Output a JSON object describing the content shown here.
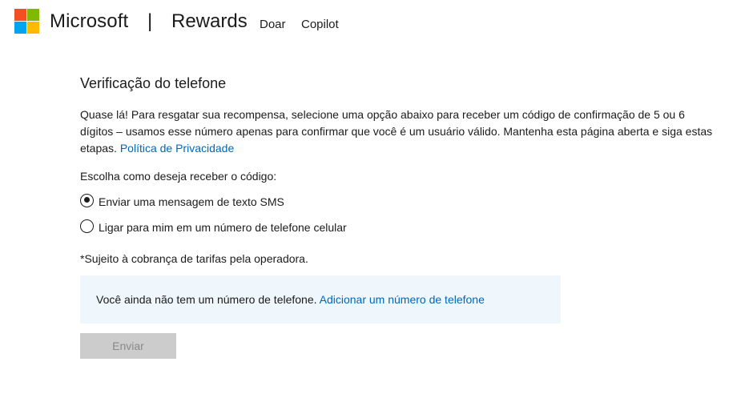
{
  "header": {
    "brand": "Microsoft",
    "divider": "|",
    "product": "Rewards",
    "nav": [
      "Doar",
      "Copilot"
    ],
    "logo_colors": [
      "#f25022",
      "#7fba00",
      "#00a4ef",
      "#ffb900"
    ]
  },
  "main": {
    "title": "Verificação do telefone",
    "intro_text": "Quase lá! Para resgatar sua recompensa, selecione uma opção abaixo para receber um código de confirmação de 5 ou 6 dígitos – usamos esse número apenas para confirmar que você é um usuário válido. Mantenha esta página aberta e siga estas etapas. ",
    "privacy_link": "Política de Privacidade",
    "choose_label": "Escolha como deseja receber o código:",
    "options": [
      {
        "label": "Enviar uma mensagem de texto SMS",
        "checked": true
      },
      {
        "label": "Ligar para mim em um número de telefone celular",
        "checked": false
      }
    ],
    "note": "*Sujeito à cobrança de tarifas pela operadora.",
    "info_text": "Você ainda não tem um número de telefone. ",
    "add_phone_link": "Adicionar um número de telefone",
    "send_button": "Enviar"
  },
  "colors": {
    "link": "#0067b8",
    "info_bg": "#eff6fc",
    "disabled_button_bg": "#cccccc"
  }
}
